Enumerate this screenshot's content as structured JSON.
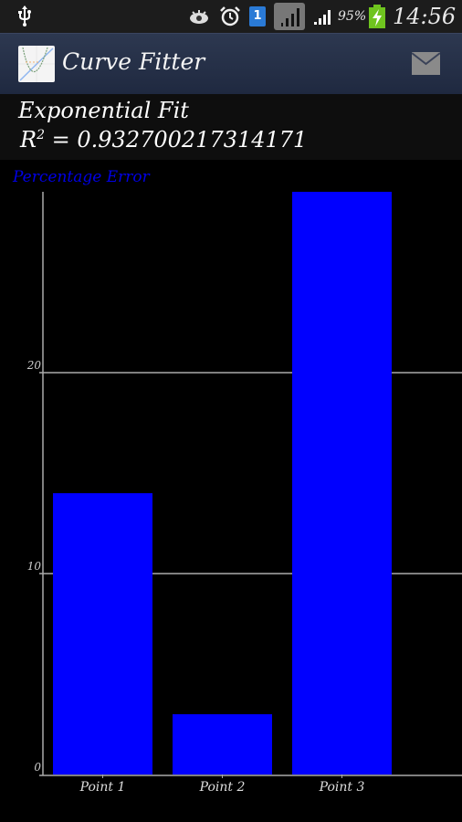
{
  "status_bar": {
    "icons": [
      "usb-icon",
      "eye-icon",
      "alarm-icon",
      "notification-badge-icon",
      "signal-box-icon",
      "signal-bars-icon",
      "battery-charging-icon"
    ],
    "notification_count": "1",
    "battery_percent": "95%",
    "time": "14:56"
  },
  "action_bar": {
    "app_icon": "curve-fitter-logo-icon",
    "title": "Curve Fitter",
    "action_icon": "mail-icon"
  },
  "fit": {
    "title": "Exponential Fit",
    "r2_label": "R",
    "r2_exp": "2",
    "r2_value": "= 0.932700217314171"
  },
  "colors": {
    "bar": "#0000ff",
    "chart_title": "#0000e6",
    "grid": "#ffffff",
    "axis": "#aaaaaa"
  },
  "chart_data": {
    "type": "bar",
    "title": "Percentage Error",
    "categories": [
      "Point 1",
      "Point 2",
      "Point 3"
    ],
    "values": [
      14,
      3,
      29
    ],
    "xlabel": "",
    "ylabel": "",
    "ylim": [
      0,
      29
    ],
    "yticks": [
      0,
      10,
      20
    ],
    "grid": true,
    "legend": "none"
  }
}
